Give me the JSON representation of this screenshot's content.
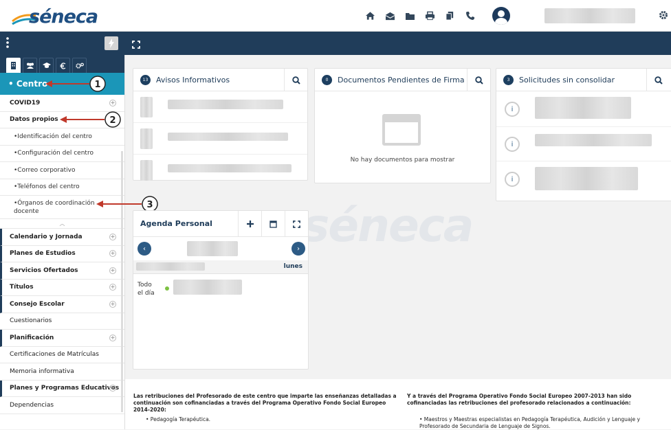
{
  "app": {
    "logo_text": "séneca",
    "watermark": "séneca"
  },
  "toolbar": {
    "icons": [
      "home-icon",
      "envelope-icon",
      "folder-icon",
      "print-icon",
      "copy-icon",
      "phone-icon",
      "user-icon",
      "gear-icon"
    ]
  },
  "sidebar": {
    "tabs": [
      "building-icon",
      "users-icon",
      "graduation-icon",
      "euro-icon",
      "gears-icon"
    ],
    "active": "• Centro",
    "items": [
      {
        "label": "COVID19",
        "bold": true,
        "plus": true
      },
      {
        "label": "Datos propios",
        "bold": true
      },
      {
        "label": "•Identificación del centro"
      },
      {
        "label": "•Configuración del centro"
      },
      {
        "label": "•Correo corporativo"
      },
      {
        "label": "•Teléfonos del centro"
      },
      {
        "label": "•Órganos de coordinación docente"
      },
      {
        "label": "Calendario y Jornada",
        "bold": true,
        "plus": true
      },
      {
        "label": "Planes de Estudios",
        "bold": true,
        "plus": true
      },
      {
        "label": "Servicios Ofertados",
        "bold": true,
        "plus": true
      },
      {
        "label": "Títulos",
        "bold": true,
        "plus": true
      },
      {
        "label": "Consejo Escolar",
        "bold": true,
        "plus": true
      },
      {
        "label": "Cuestionarios"
      },
      {
        "label": "Planificación",
        "bold": true,
        "plus": true
      },
      {
        "label": "Certificaciones de Matrículas"
      },
      {
        "label": "Memoria informativa"
      },
      {
        "label": "Planes y Programas Educativos",
        "bold": true,
        "plus": true
      },
      {
        "label": "Dependencias"
      }
    ]
  },
  "annotations": [
    "1",
    "2",
    "3"
  ],
  "avisos": {
    "badge": "13",
    "title": "Avisos Informativos"
  },
  "documentos": {
    "badge": "0",
    "title": "Documentos Pendientes de Firma",
    "empty": "No hay documentos para mostrar"
  },
  "solicitudes": {
    "badge": "3",
    "title": "Solicitudes sin consolidar"
  },
  "agenda": {
    "title": "Agenda Personal",
    "day": "lunes",
    "allday": "Todo el día"
  },
  "footer": {
    "left_text": "Las retribuciones del Profesorado de este centro que imparte las enseñanzas detalladas a continuación son cofinanciadas a través del Programa Operativo Fondo Social Europeo 2014-2020:",
    "left_item": "• Pedagogía Terapéutica.",
    "right_text": "Y a través del Programa Operativo Fondo Social Europeo 2007-2013 han sido cofinanciadas las retribuciones del profesorado relacionados a continuación:",
    "right_item": "• Maestros y Maestras especialistas en Pedagogía Terapéutica, Audición y Lenguaje y Profesorado de Secundaria de Lenguaje de Signos."
  }
}
